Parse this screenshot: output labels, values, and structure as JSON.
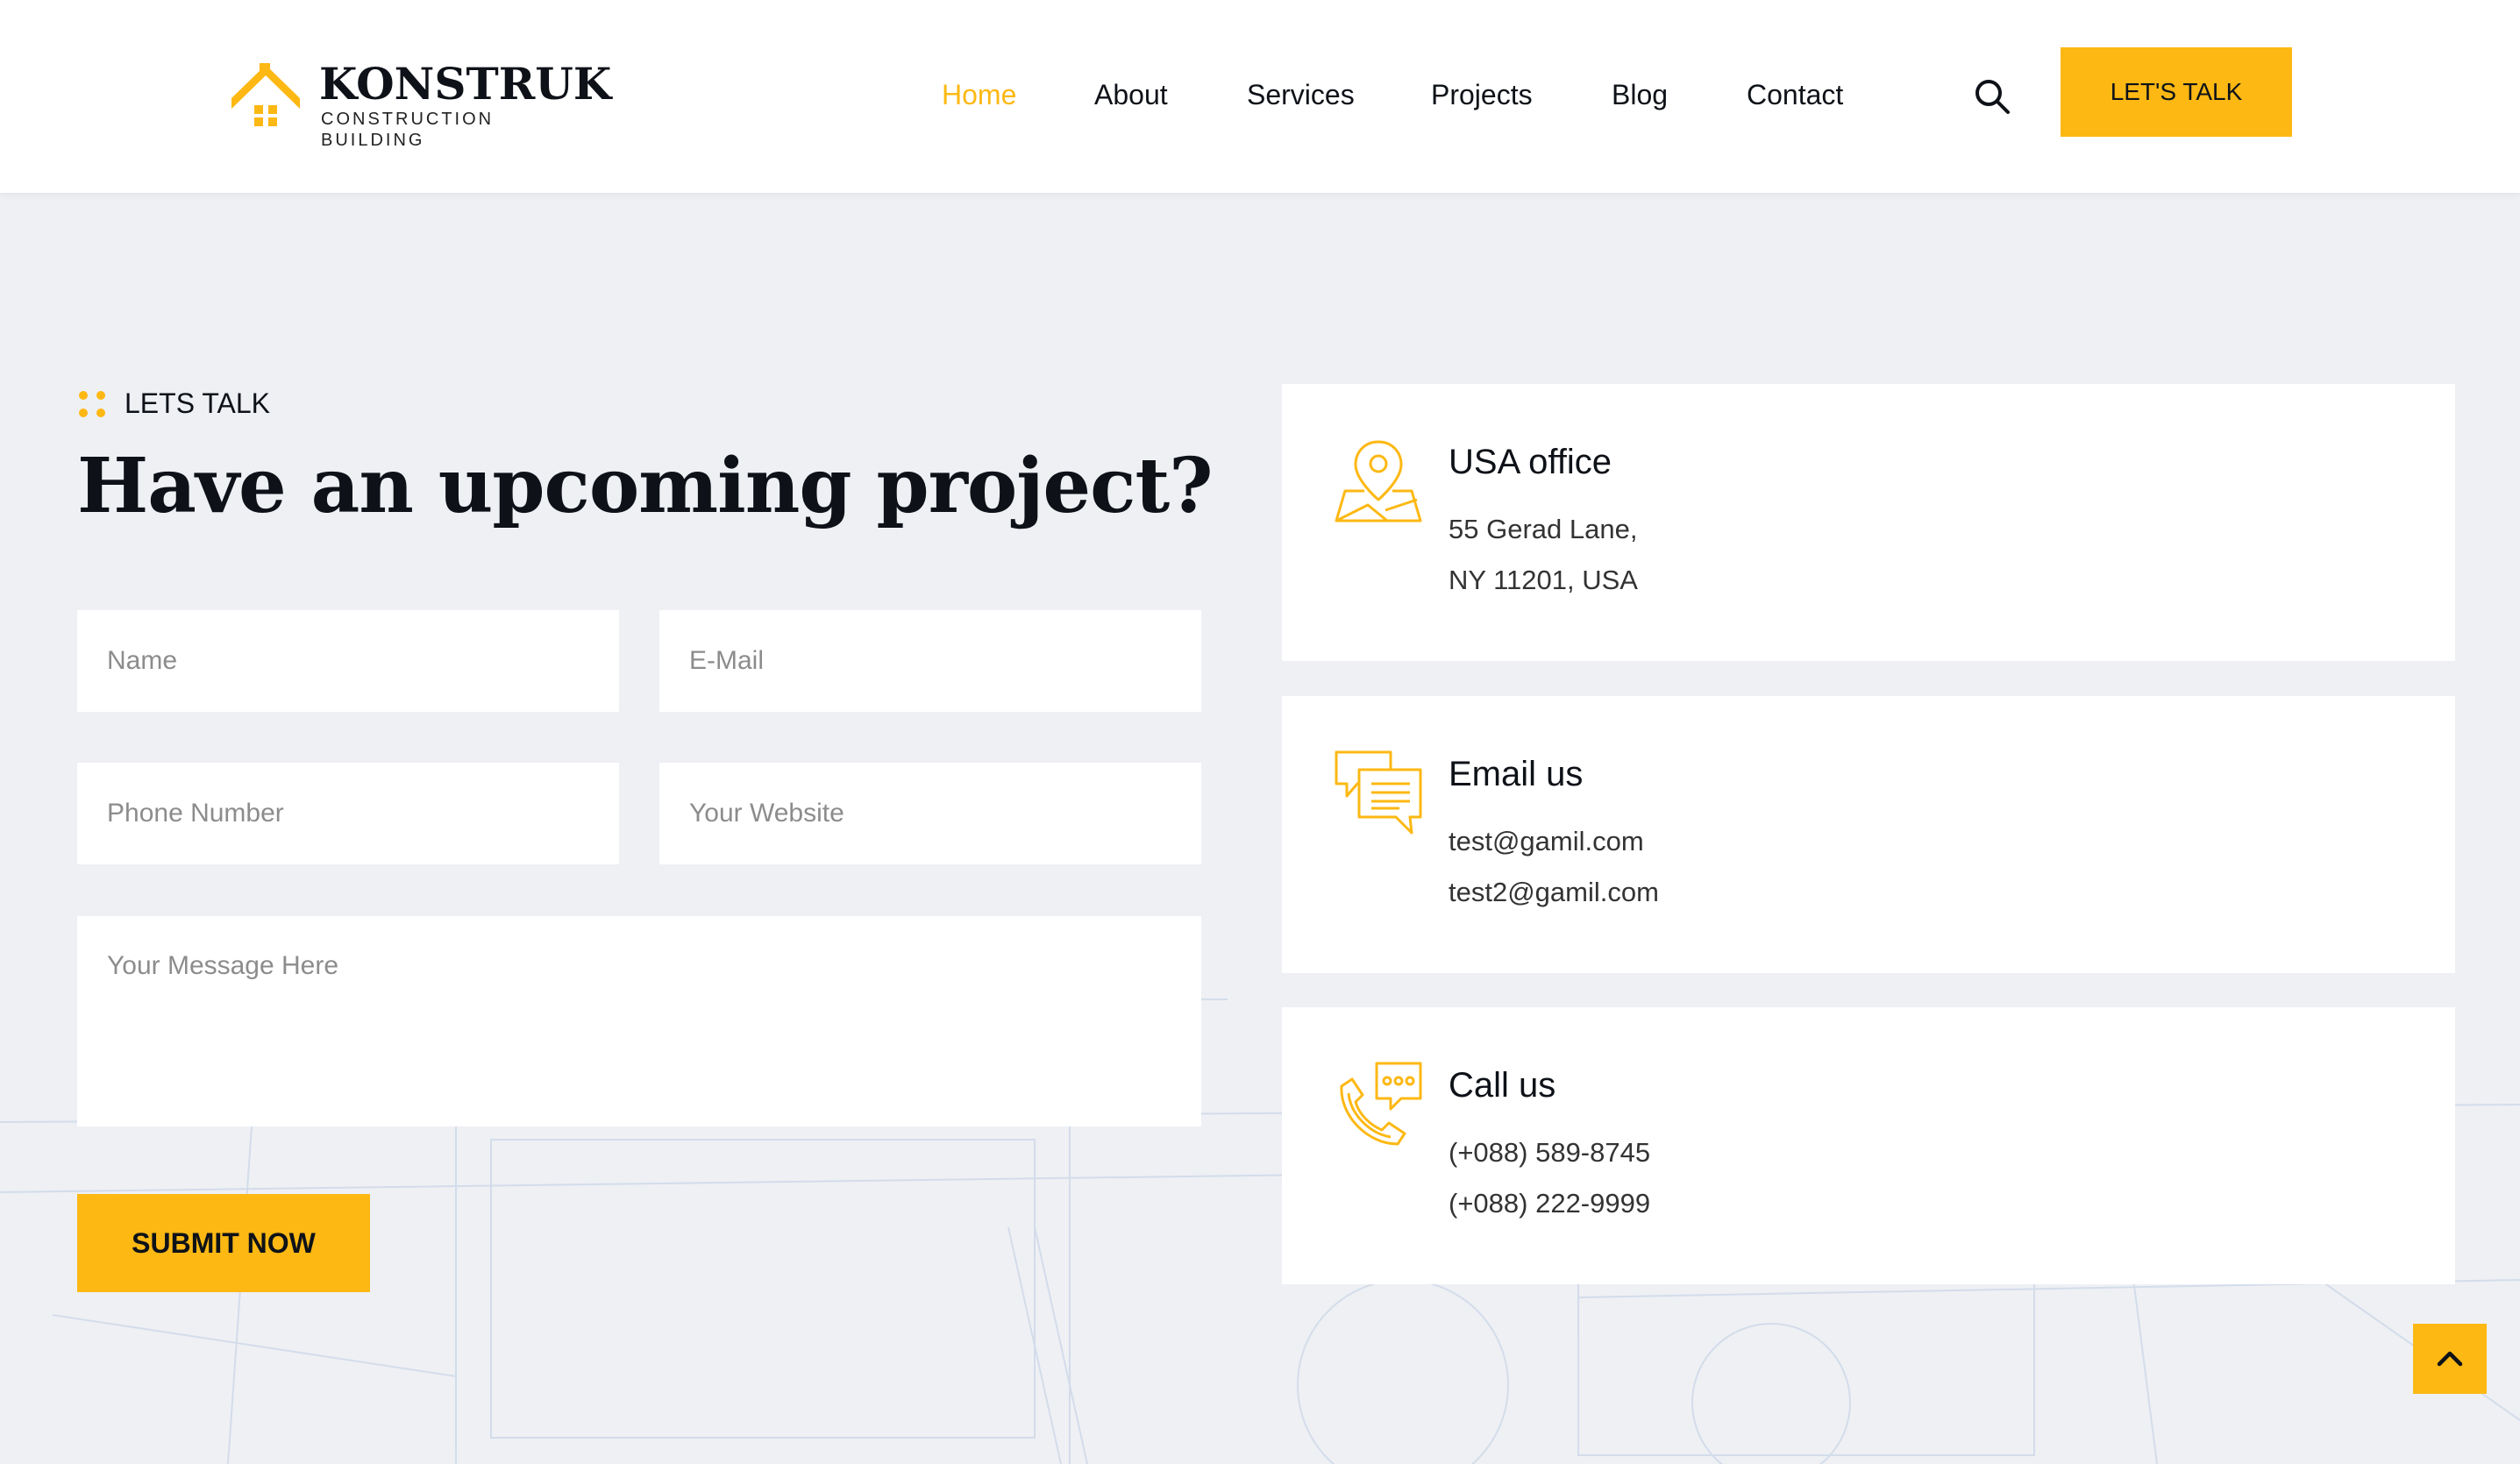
{
  "brand": {
    "name": "KONSTRUK",
    "tagline": "CONSTRUCTION BUILDING",
    "accent_color": "#fdb813",
    "logo_icon": "house-icon"
  },
  "nav": {
    "items": [
      {
        "label": "Home",
        "active": true
      },
      {
        "label": "About",
        "active": false
      },
      {
        "label": "Services",
        "active": false
      },
      {
        "label": "Projects",
        "active": false
      },
      {
        "label": "Blog",
        "active": false
      },
      {
        "label": "Contact",
        "active": false
      }
    ],
    "search_icon": "search-icon",
    "cta_label": "LET'S TALK"
  },
  "section": {
    "eyebrow": "LETS TALK",
    "heading": "Have an upcoming project?"
  },
  "form": {
    "name_placeholder": "Name",
    "email_placeholder": "E-Mail",
    "phone_placeholder": "Phone Number",
    "website_placeholder": "Your Website",
    "message_placeholder": "Your Message Here",
    "submit_label": "SUBMIT NOW"
  },
  "contacts": [
    {
      "icon": "location-pin-icon",
      "title": "USA office",
      "line1": "55 Gerad Lane,",
      "line2": "NY 11201, USA"
    },
    {
      "icon": "chat-bubbles-icon",
      "title": "Email us",
      "line1": "test@gamil.com",
      "line2": "test2@gamil.com"
    },
    {
      "icon": "phone-call-icon",
      "title": "Call us",
      "line1": "(+088) 589-8745",
      "line2": "(+088) 222-9999"
    }
  ],
  "back_to_top_icon": "chevron-up-icon"
}
